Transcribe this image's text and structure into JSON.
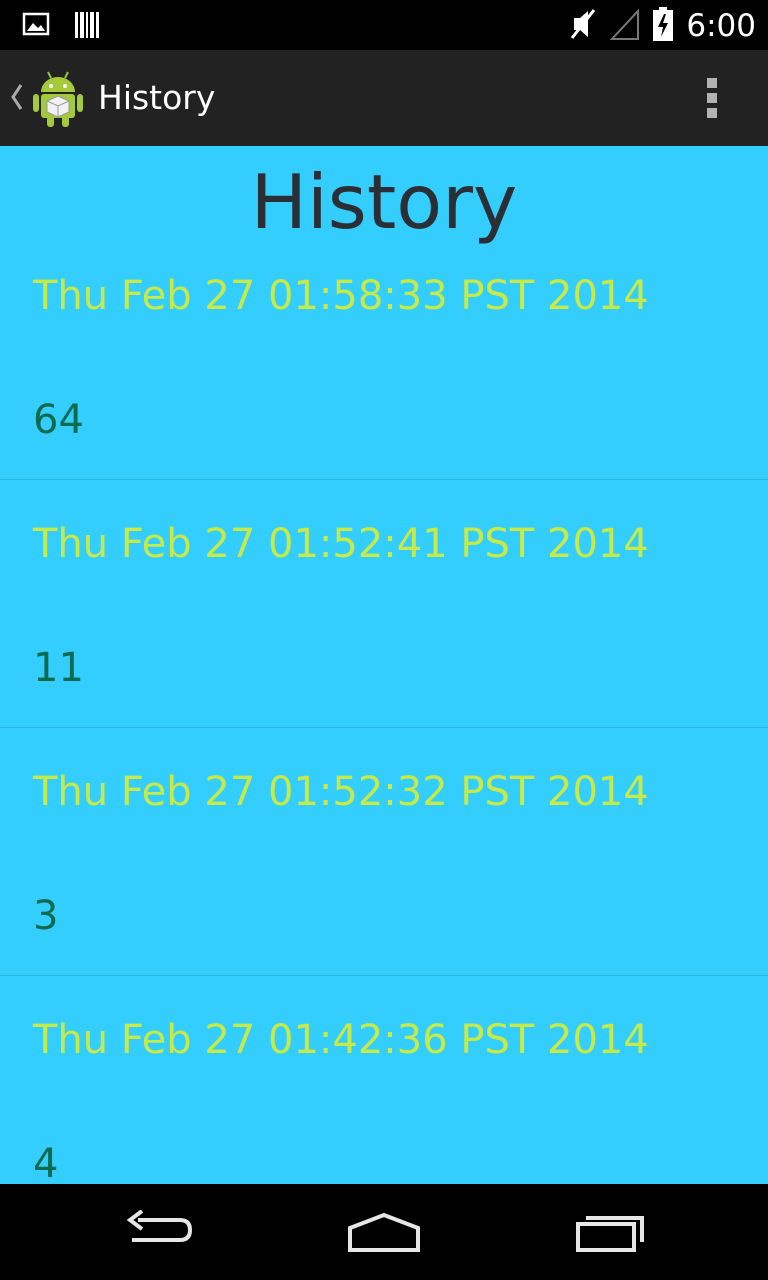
{
  "status_bar": {
    "time": "6:00",
    "icons": [
      "image-notification-icon",
      "barcode-notification-icon",
      "mute-icon",
      "signal-icon",
      "battery-charging-icon"
    ]
  },
  "action_bar": {
    "title": "History",
    "icons": [
      "up-caret-icon",
      "android-app-icon",
      "overflow-menu-icon"
    ]
  },
  "page": {
    "title": "History"
  },
  "history": [
    {
      "date": "Thu Feb 27 01:58:33 PST 2014",
      "value": "64"
    },
    {
      "date": "Thu Feb 27 01:52:41 PST 2014",
      "value": "11"
    },
    {
      "date": "Thu Feb 27 01:52:32 PST 2014",
      "value": "3"
    },
    {
      "date": "Thu Feb 27 01:42:36 PST 2014",
      "value": "4"
    }
  ],
  "nav_bar": {
    "icons": [
      "back-icon",
      "home-icon",
      "recent-apps-icon"
    ]
  },
  "colors": {
    "content_background": "#33cdfe",
    "date_text": "#c7ea46",
    "value_text": "#0c6b4e",
    "title_text": "#2a2f36",
    "action_bar": "#222222"
  }
}
